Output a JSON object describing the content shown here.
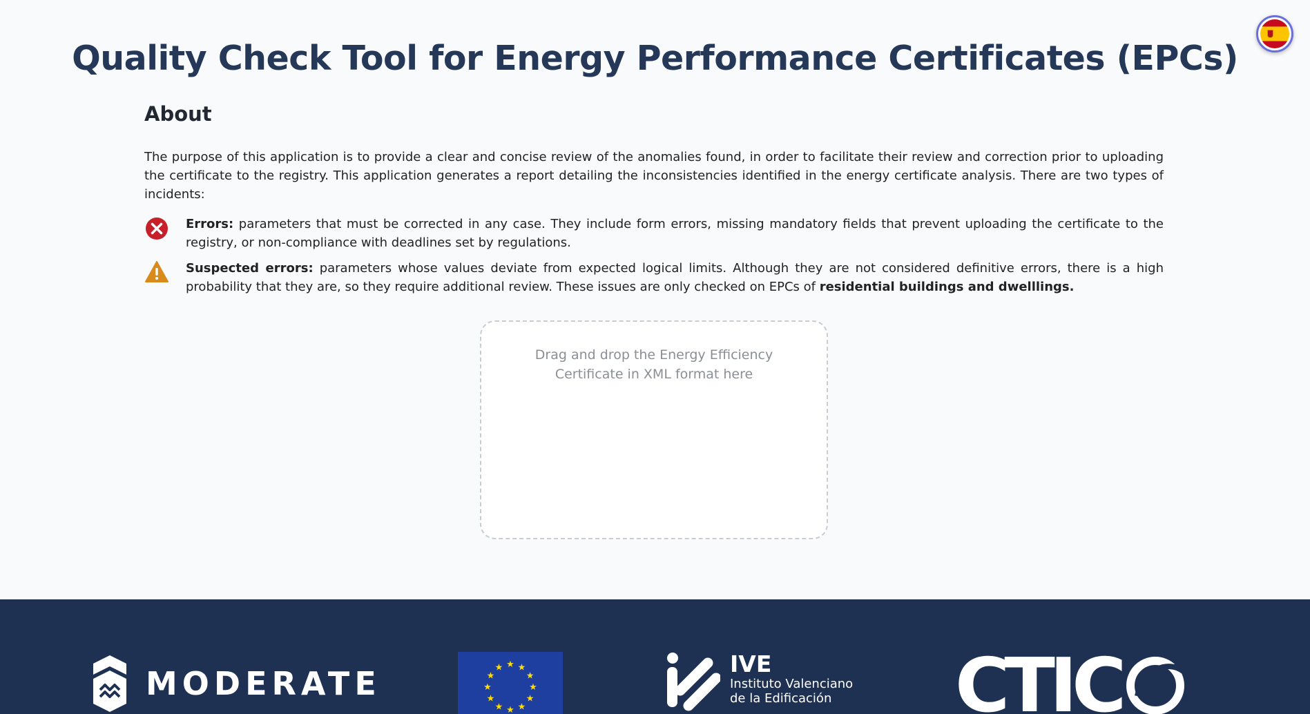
{
  "header": {
    "title": "Quality Check Tool for Energy Performance Certificates (EPCs)",
    "language_icon": "spain-flag-icon"
  },
  "about": {
    "heading": "About",
    "intro": "The purpose of this application is to provide a clear and concise review of the anomalies found, in order to facilitate their review and correction prior to uploading the certificate to the registry. This application generates a report detailing the inconsistencies identified in the energy certificate analysis. There are two types of incidents:",
    "incidents": [
      {
        "icon": "error-circle-icon",
        "label": "Errors:",
        "text": " parameters that must be corrected in any case. They include form errors, missing mandatory fields that prevent uploading the certificate to the registry, or non-compliance with deadlines set by regulations."
      },
      {
        "icon": "warning-triangle-icon",
        "label": "Suspected errors:",
        "text": " parameters whose values deviate from expected logical limits. Although they are not considered definitive errors, there is a high probability that they are, so they require additional review. These issues are only checked on EPCs of ",
        "emphasis": "residential buildings and dwelllings."
      }
    ]
  },
  "dropzone": {
    "label": "Drag and drop the Energy Efficiency Certificate in XML format here"
  },
  "footer": {
    "logos": {
      "moderate": "MODERATE",
      "ive_title": "IVE",
      "ive_line1": "Instituto Valenciano",
      "ive_line2": "de la Edificación",
      "ctic": "CTIC"
    }
  },
  "colors": {
    "title": "#253858",
    "footer_bg": "#1f3152",
    "error_red": "#c8202a",
    "warning_amber": "#d98a1c",
    "eu_blue": "#1f3fa0",
    "eu_star": "#ffdd00"
  }
}
